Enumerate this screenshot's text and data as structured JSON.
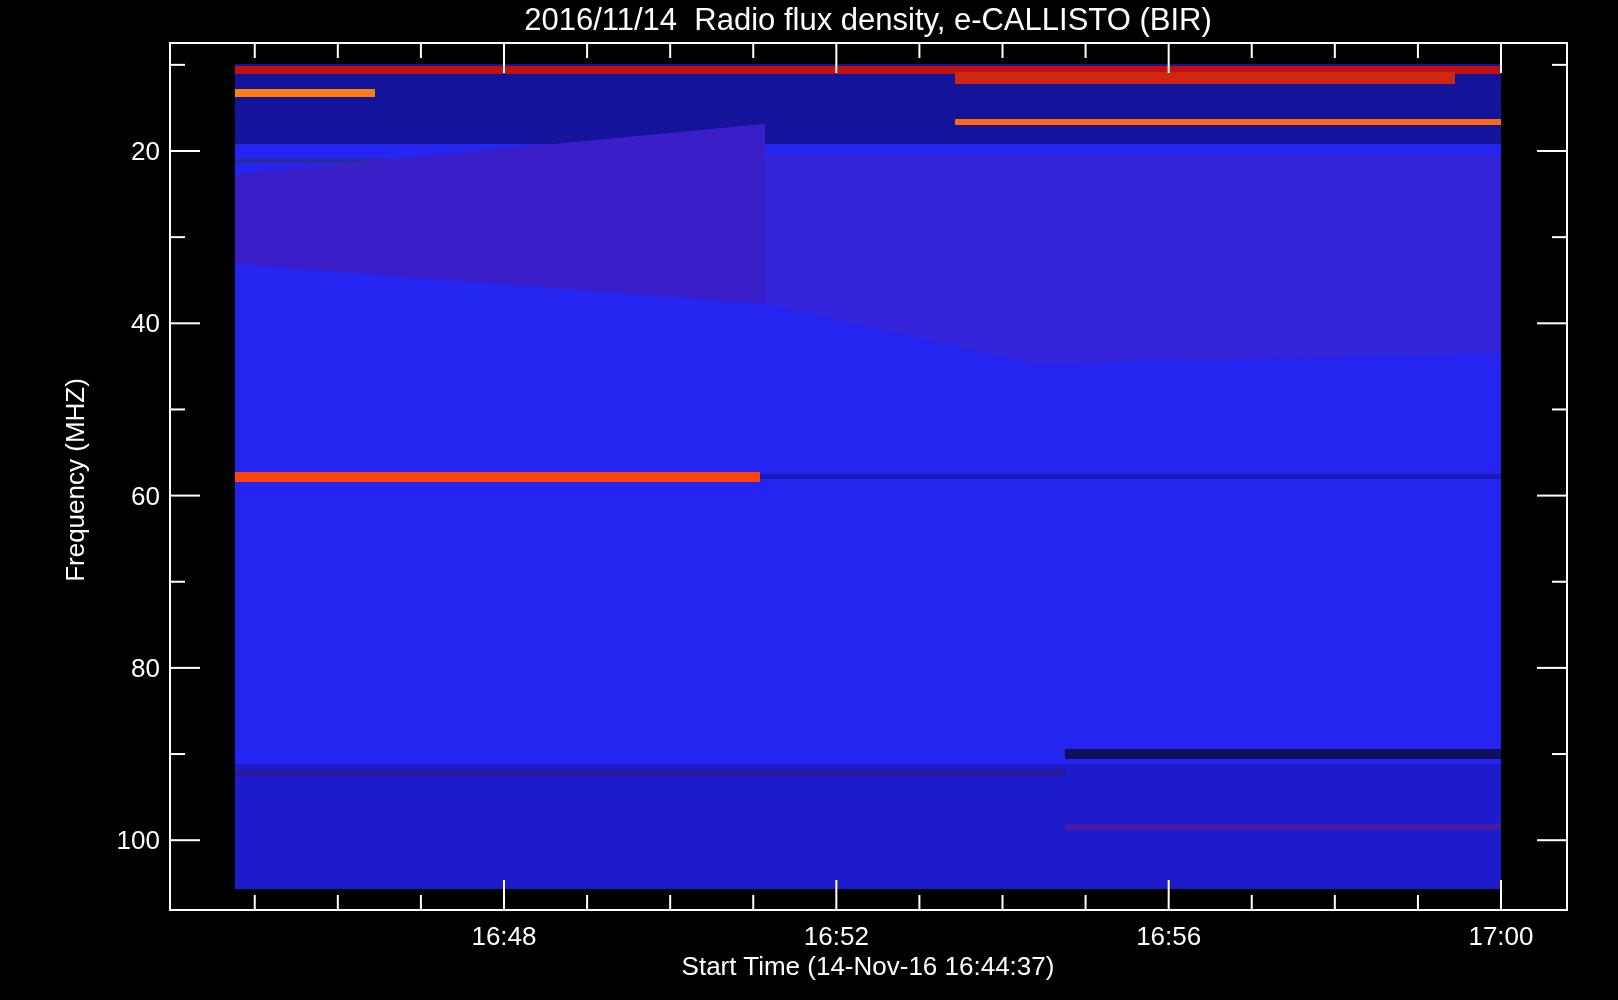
{
  "title": "2016/11/14  Radio flux density, e-CALLISTO (BIR)",
  "y_axis": {
    "label": "Frequency (MHZ)",
    "ticks": [
      "20",
      "40",
      "60",
      "80",
      "100"
    ]
  },
  "x_axis": {
    "label": "Start Time (14-Nov-16 16:44:37)",
    "ticks": [
      "16:48",
      "16:52",
      "16:56",
      "17:00"
    ]
  }
}
